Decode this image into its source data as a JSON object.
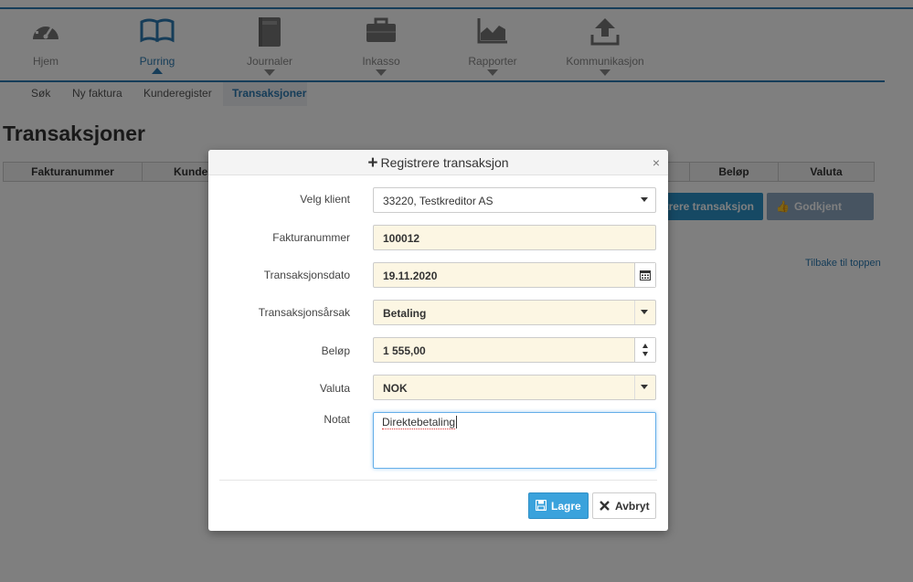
{
  "nav": {
    "items": [
      {
        "label": "Hjem",
        "icon": "speedometer-icon"
      },
      {
        "label": "Purring",
        "icon": "book-icon"
      },
      {
        "label": "Journaler",
        "icon": "journal-icon"
      },
      {
        "label": "Inkasso",
        "icon": "briefcase-icon"
      },
      {
        "label": "Rapporter",
        "icon": "chart-icon"
      },
      {
        "label": "Kommunikasjon",
        "icon": "upload-icon"
      }
    ],
    "active": "Purring"
  },
  "subnav": {
    "items": [
      "Søk",
      "Ny faktura",
      "Kunderegister",
      "Transaksjoner"
    ],
    "active": "Transaksjoner"
  },
  "page": {
    "title": "Transaksjoner",
    "table_headers": [
      "Fakturanummer",
      "Kunde",
      "Beløp",
      "Valuta"
    ],
    "register_button": "strere transaksjon",
    "approve_button": "Godkjent bundt",
    "back_to_top": "Tilbake til toppen"
  },
  "modal": {
    "title": "Registrere transaksjon",
    "close": "×",
    "fields": {
      "client": {
        "label": "Velg klient",
        "value": "33220, Testkreditor AS"
      },
      "invoice": {
        "label": "Fakturanummer",
        "value": "100012"
      },
      "date": {
        "label": "Transaksjonsdato",
        "value": "19.11.2020"
      },
      "reason": {
        "label": "Transaksjonsårsak",
        "value": "Betaling"
      },
      "amount": {
        "label": "Beløp",
        "value": "1 555,00"
      },
      "currency": {
        "label": "Valuta",
        "value": "NOK"
      },
      "note": {
        "label": "Notat",
        "value": "Direktebetaling"
      }
    },
    "save_label": "Lagre",
    "cancel_label": "Avbryt"
  },
  "colors": {
    "accent": "#2c7bb3",
    "save_button": "#3aa2dc",
    "field_highlight": "#fcf6e3"
  }
}
